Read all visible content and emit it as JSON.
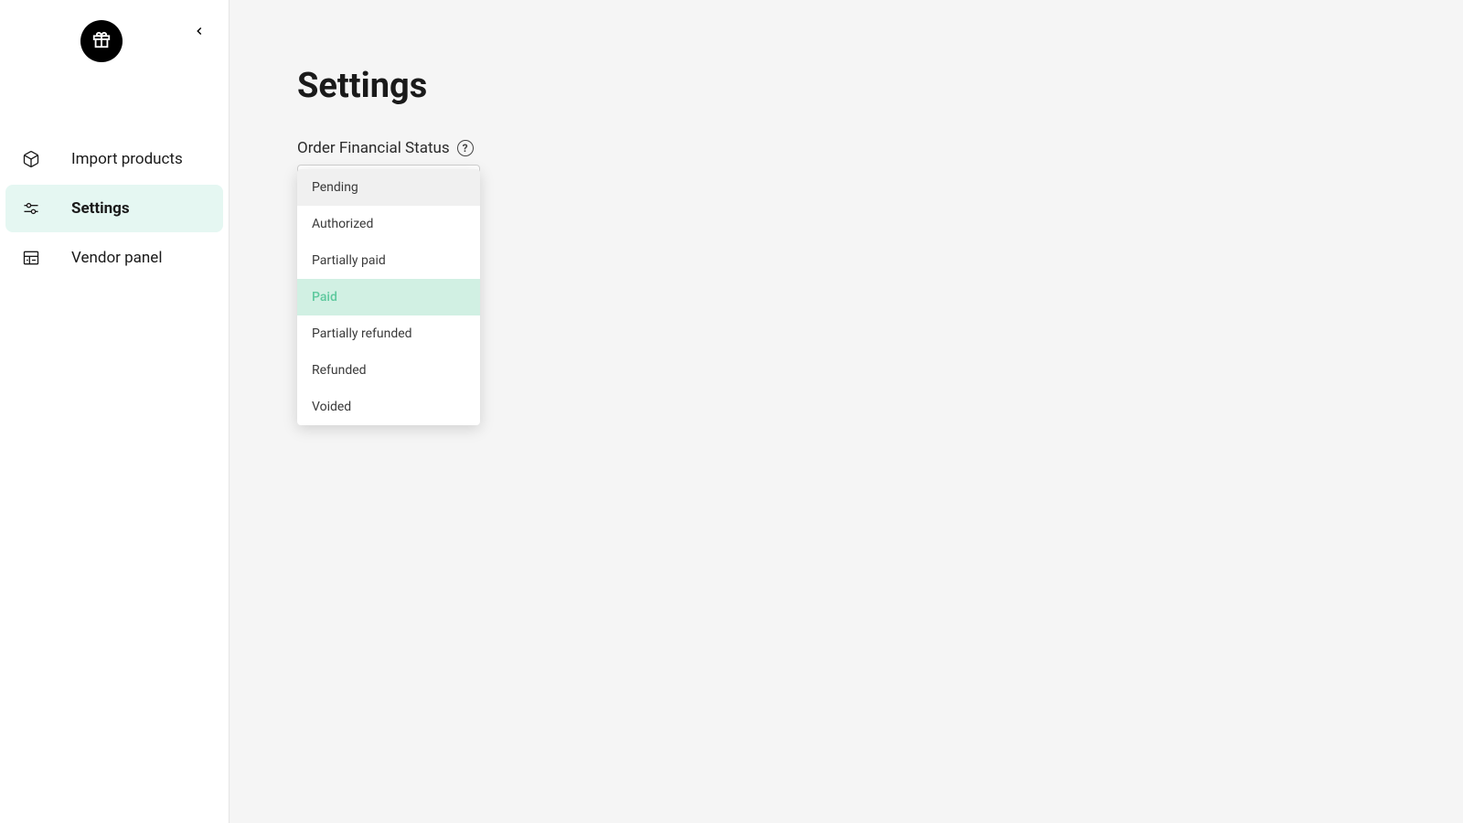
{
  "sidebar": {
    "nav_items": [
      {
        "label": "Import products",
        "icon": "box-icon",
        "active": false
      },
      {
        "label": "Settings",
        "icon": "sliders-icon",
        "active": true
      },
      {
        "label": "Vendor panel",
        "icon": "panel-icon",
        "active": false
      }
    ]
  },
  "main": {
    "title": "Settings",
    "field_label": "Order Financial Status",
    "dropdown": {
      "options": [
        {
          "label": "Pending",
          "hovered": true,
          "selected": false
        },
        {
          "label": "Authorized",
          "hovered": false,
          "selected": false
        },
        {
          "label": "Partially paid",
          "hovered": false,
          "selected": false
        },
        {
          "label": "Paid",
          "hovered": false,
          "selected": true
        },
        {
          "label": "Partially refunded",
          "hovered": false,
          "selected": false
        },
        {
          "label": "Refunded",
          "hovered": false,
          "selected": false
        },
        {
          "label": "Voided",
          "hovered": false,
          "selected": false
        }
      ]
    }
  }
}
